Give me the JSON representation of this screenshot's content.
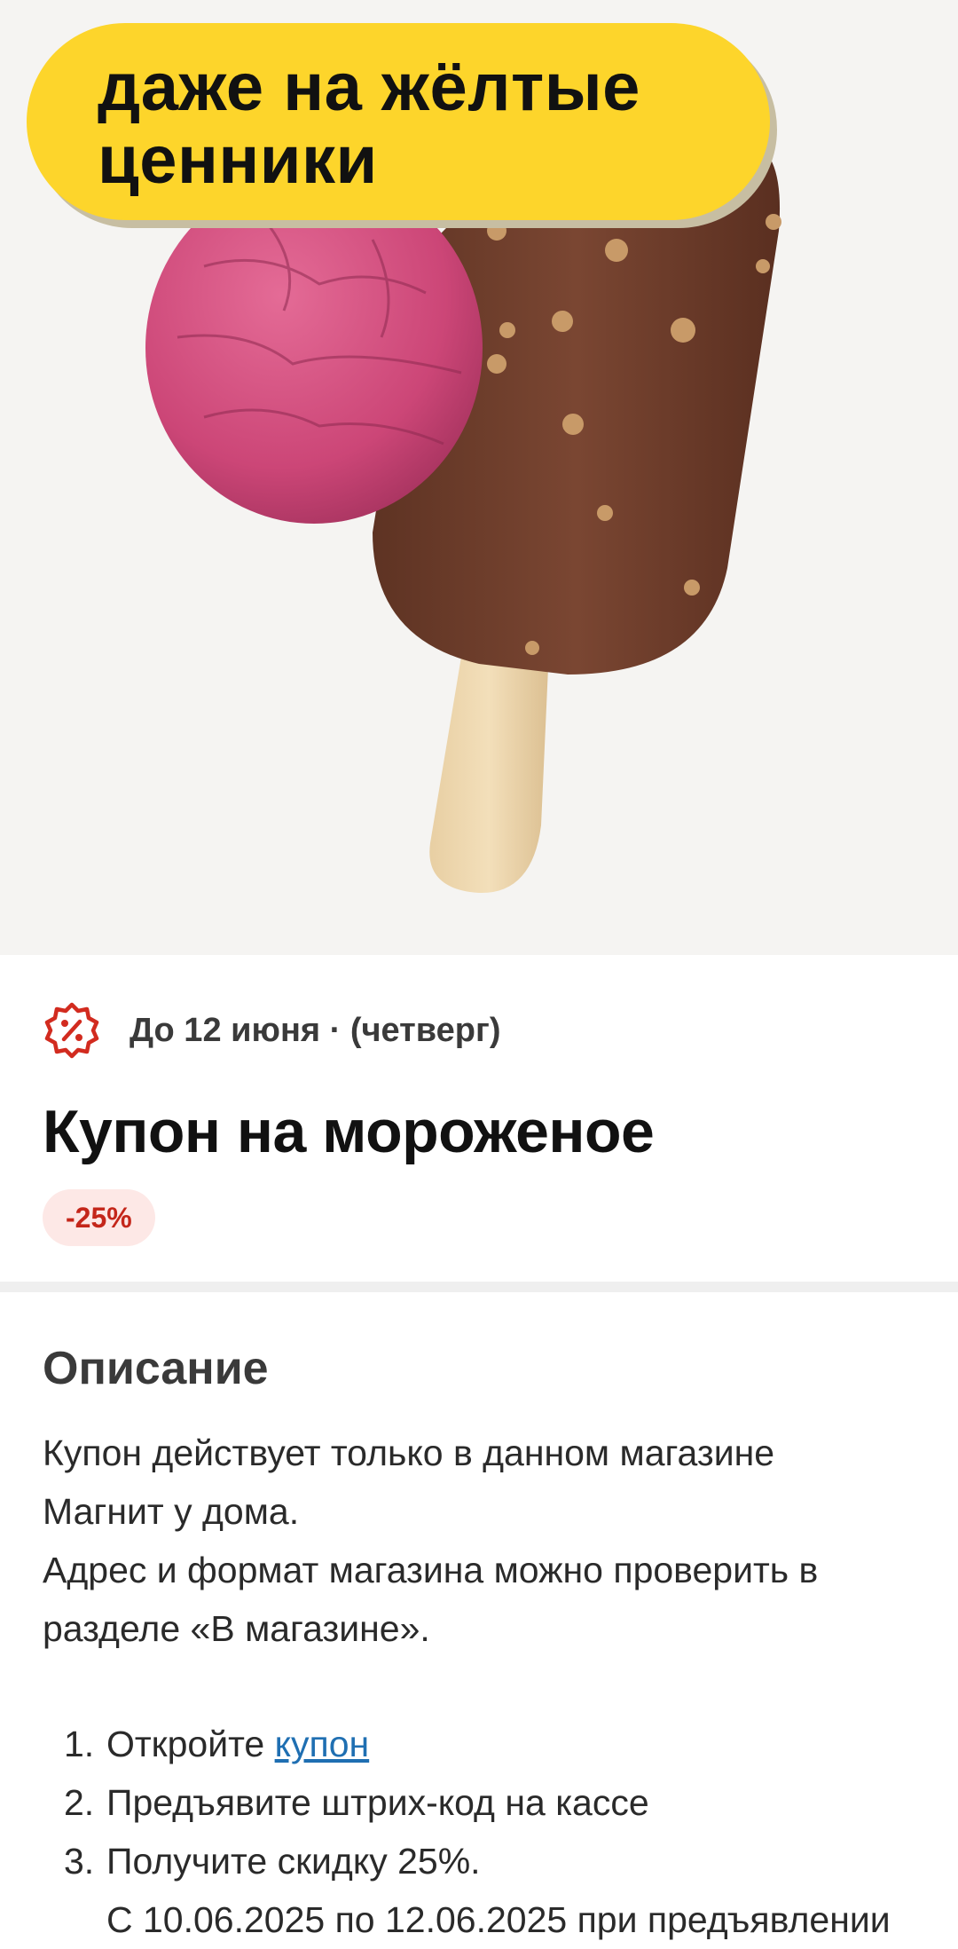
{
  "hero": {
    "promo_line1": "даже на жёлтые",
    "promo_line2": "ценники",
    "promo_color": "#fdd52b",
    "background_color": "#f5f4f2"
  },
  "coupon": {
    "icon": "percent-badge-icon",
    "icon_color": "#d22b1f",
    "valid_until": "До 12 июня · (четверг)",
    "title": "Купон на мороженое",
    "discount_badge": "-25%"
  },
  "description": {
    "heading": "Описание",
    "paragraph1_line1": "Купон действует только в данном магазине",
    "paragraph1_line2": "Магнит у дома.",
    "paragraph2_line1": "Адрес и формат магазина можно проверить в",
    "paragraph2_line2": "разделе «В магазине».",
    "steps": [
      {
        "num": "1.",
        "text": "Откройте ",
        "link": "купон"
      },
      {
        "num": "2.",
        "text": "Предъявите штрих-код на кассе"
      },
      {
        "num": "3.",
        "text": "Получите скидку 25%."
      }
    ],
    "note_partial": "С 10.06.2025 по 12.06.2025 при предъявлении"
  }
}
